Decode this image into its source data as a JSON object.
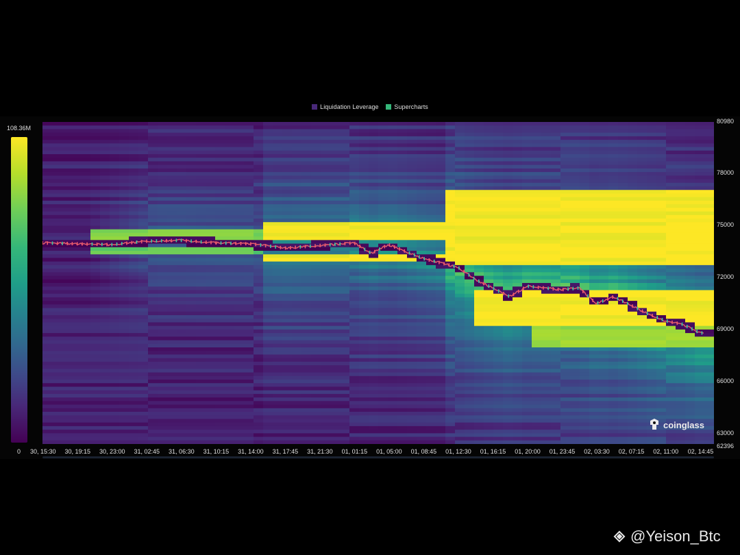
{
  "legend": [
    {
      "label": "Liquidation Leverage",
      "color": "#482878"
    },
    {
      "label": "Supercharts",
      "color": "#35b779"
    }
  ],
  "colorbar": {
    "max_label": "108.36M",
    "min_label": "0"
  },
  "brand": {
    "label": "coinglass"
  },
  "watermark": {
    "label": "@Yeison_Btc"
  },
  "chart_data": {
    "type": "heatmap",
    "title": "",
    "xlabel": "",
    "ylabel": "",
    "x_ticks": [
      "30, 15:30",
      "30, 19:15",
      "30, 23:00",
      "31, 02:45",
      "31, 06:30",
      "31, 10:15",
      "31, 14:00",
      "31, 17:45",
      "31, 21:30",
      "01, 01:15",
      "01, 05:00",
      "01, 08:45",
      "01, 12:30",
      "01, 16:15",
      "01, 20:00",
      "01, 23:45",
      "02, 03:30",
      "02, 07:15",
      "02, 11:00",
      "02, 14:45"
    ],
    "y_ticks": [
      80980,
      78000,
      75000,
      72000,
      69000,
      66000,
      63000,
      62396
    ],
    "ylim": [
      62396,
      80980
    ],
    "colorscale": "viridis",
    "value_range": [
      0,
      108360000
    ],
    "price_path": [
      {
        "t": 0,
        "p": 74000
      },
      {
        "t": 1,
        "p": 73950
      },
      {
        "t": 2,
        "p": 73900
      },
      {
        "t": 3,
        "p": 74100
      },
      {
        "t": 4,
        "p": 74150
      },
      {
        "t": 5,
        "p": 74000
      },
      {
        "t": 6,
        "p": 73950
      },
      {
        "t": 7,
        "p": 73700
      },
      {
        "t": 8,
        "p": 73850
      },
      {
        "t": 9,
        "p": 74000
      },
      {
        "t": 9.5,
        "p": 73400
      },
      {
        "t": 10,
        "p": 73900
      },
      {
        "t": 11,
        "p": 73100
      },
      {
        "t": 12,
        "p": 72600
      },
      {
        "t": 12.5,
        "p": 71900
      },
      {
        "t": 13,
        "p": 71400
      },
      {
        "t": 13.5,
        "p": 70900
      },
      {
        "t": 14,
        "p": 71500
      },
      {
        "t": 15,
        "p": 71300
      },
      {
        "t": 15.5,
        "p": 71400
      },
      {
        "t": 16,
        "p": 70500
      },
      {
        "t": 16.5,
        "p": 70900
      },
      {
        "t": 17,
        "p": 70400
      },
      {
        "t": 17.5,
        "p": 69900
      },
      {
        "t": 18,
        "p": 69500
      },
      {
        "t": 18.5,
        "p": 69300
      },
      {
        "t": 19,
        "p": 68800
      }
    ],
    "liquidation_bands": [
      {
        "t_start": 1.3,
        "t_end": 6.5,
        "p_low": 74100,
        "p_high": 74700,
        "intensity": 0.8
      },
      {
        "t_start": 1.3,
        "t_end": 6.5,
        "p_low": 73300,
        "p_high": 73700,
        "intensity": 0.75
      },
      {
        "t_start": 6.5,
        "t_end": 11.7,
        "p_low": 74200,
        "p_high": 75200,
        "intensity": 1.0
      },
      {
        "t_start": 6.5,
        "t_end": 11.7,
        "p_low": 72900,
        "p_high": 73400,
        "intensity": 1.0
      },
      {
        "t_start": 11.7,
        "t_end": 19.7,
        "p_low": 72700,
        "p_high": 77000,
        "intensity": 1.0
      },
      {
        "t_start": 12.5,
        "t_end": 19.7,
        "p_low": 69300,
        "p_high": 71200,
        "intensity": 1.0
      },
      {
        "t_start": 14,
        "t_end": 19.7,
        "p_low": 68000,
        "p_high": 69300,
        "intensity": 0.85
      }
    ]
  }
}
